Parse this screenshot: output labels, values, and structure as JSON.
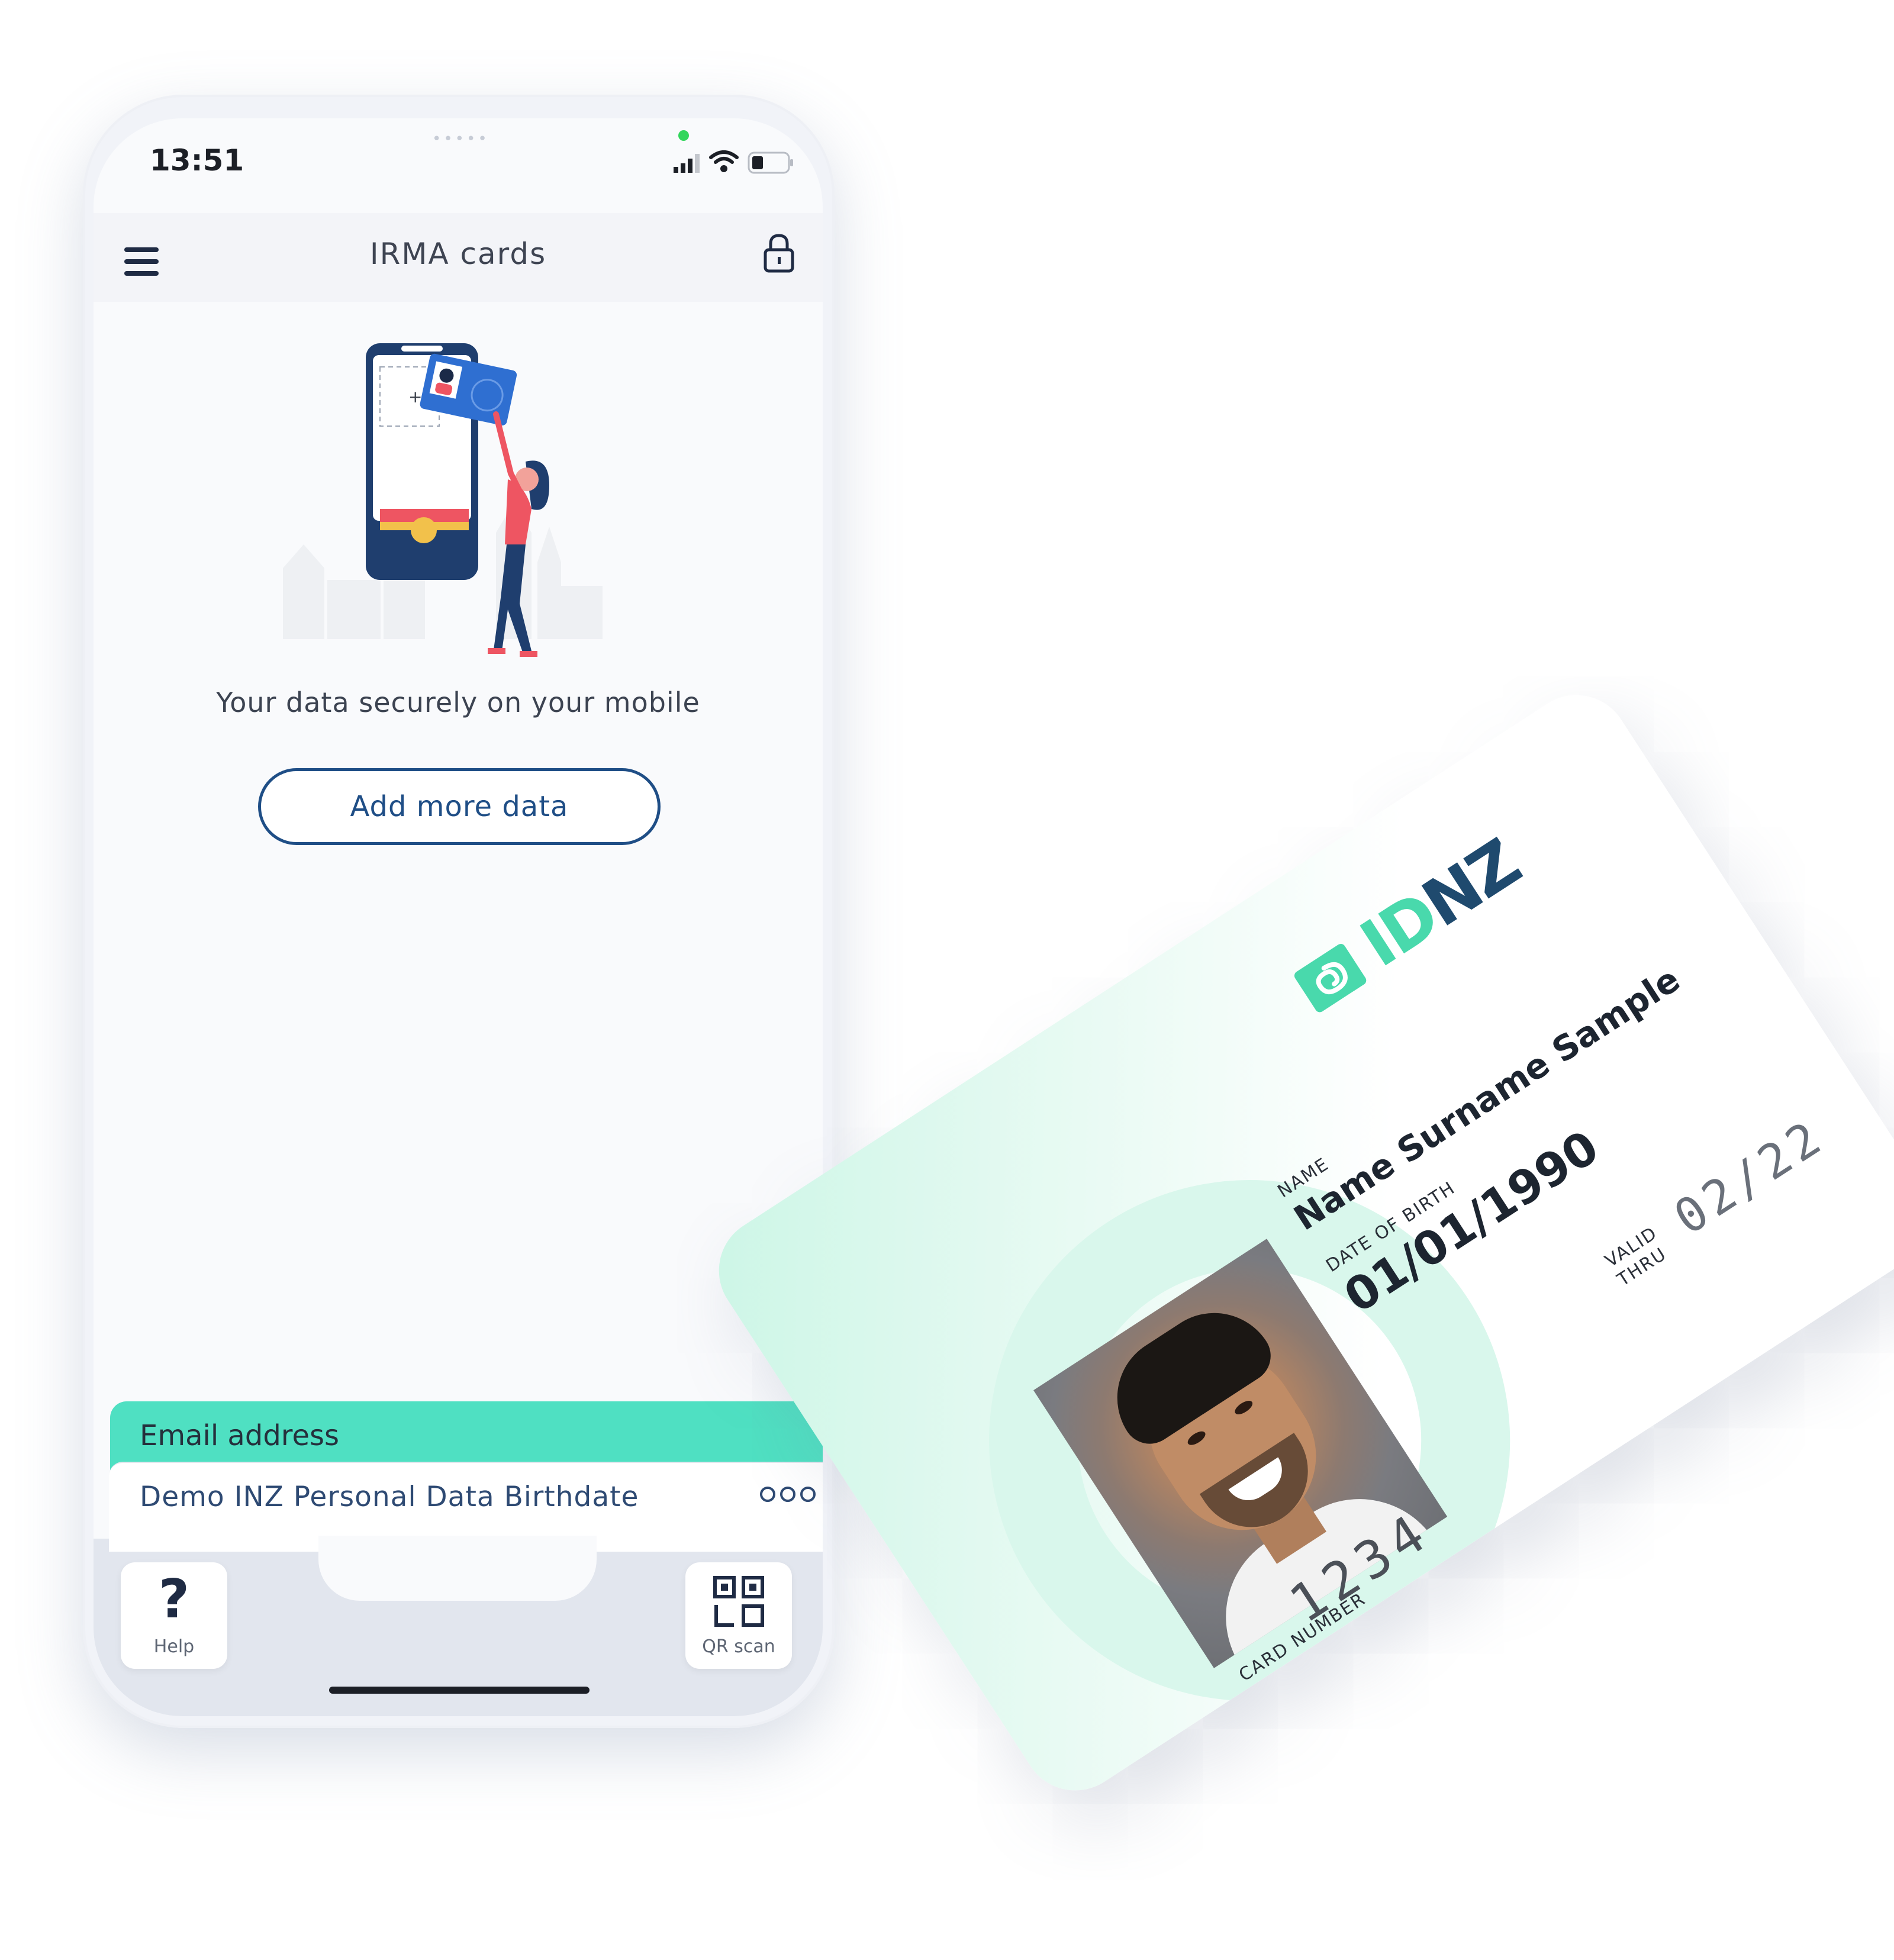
{
  "status_bar": {
    "time": "13:51"
  },
  "header": {
    "title": "IRMA cards"
  },
  "empty_state": {
    "tagline": "Your data securely on your mobile",
    "add_button": "Add more data"
  },
  "cards": [
    {
      "label": "Email address",
      "color": "#4fe0c2"
    },
    {
      "label": "Demo INZ Personal Data Birthdate",
      "color": "#ffffff"
    }
  ],
  "bottom_bar": {
    "help_label": "Help",
    "qr_label": "QR scan"
  },
  "id_card": {
    "logo": "IDNZ",
    "name_label": "NAME",
    "name_value": "Name Surname Sample",
    "dob_label": "DATE OF BIRTH",
    "dob_value": "01/01/1990",
    "card_number_label": "CARD NUMBER",
    "card_number_value": "1234",
    "valid_label_1": "VALID",
    "valid_label_2": "THRU",
    "valid_value": "02/22"
  },
  "colors": {
    "accent": "#1f4e86",
    "mint": "#4fe0c2",
    "logo_green": "#49d9ac",
    "logo_navy": "#1f4a6e"
  }
}
